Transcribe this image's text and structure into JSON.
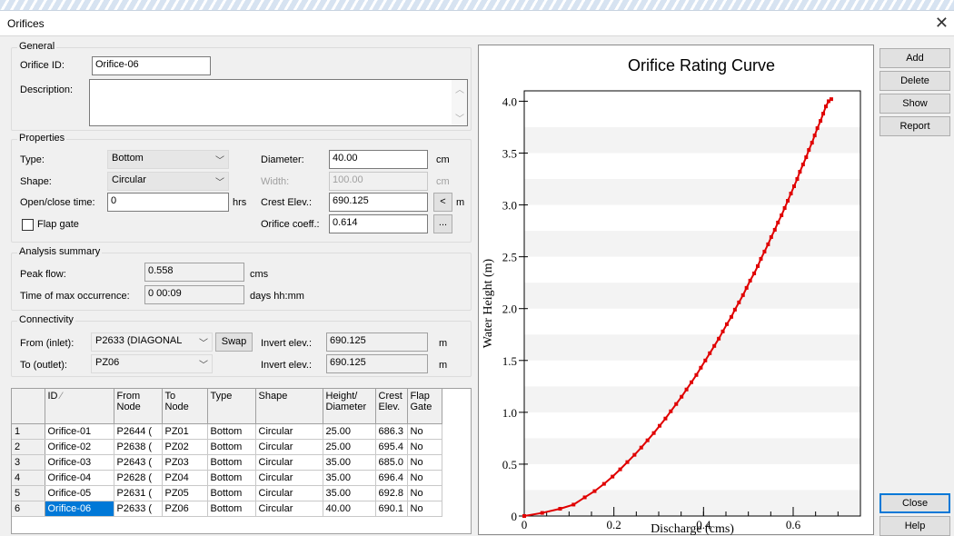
{
  "window": {
    "title": "Orifices",
    "close_glyph": "✕"
  },
  "general": {
    "group_label": "General",
    "orifice_id_label": "Orifice ID:",
    "orifice_id_value": "Orifice-06",
    "description_label": "Description:",
    "description_value": ""
  },
  "properties": {
    "group_label": "Properties",
    "type_label": "Type:",
    "type_value": "Bottom",
    "shape_label": "Shape:",
    "shape_value": "Circular",
    "open_close_label": "Open/close time:",
    "open_close_value": "0",
    "open_close_unit": "hrs",
    "flap_gate_label": "Flap gate",
    "flap_gate_checked": false,
    "diameter_label": "Diameter:",
    "diameter_value": "40.00",
    "diameter_unit": "cm",
    "width_label": "Width:",
    "width_value": "100.00",
    "width_unit": "cm",
    "crest_elev_label": "Crest Elev.:",
    "crest_elev_value": "690.125",
    "crest_elev_btn": "<",
    "crest_elev_unit": "m",
    "coeff_label": "Orifice coeff.:",
    "coeff_value": "0.614",
    "coeff_btn": "..."
  },
  "analysis": {
    "group_label": "Analysis summary",
    "peak_flow_label": "Peak flow:",
    "peak_flow_value": "0.558",
    "peak_flow_unit": "cms",
    "time_max_label": "Time of max occurrence:",
    "time_max_value": "0  00:09",
    "time_max_unit": "days hh:mm"
  },
  "connectivity": {
    "group_label": "Connectivity",
    "from_label": "From (inlet):",
    "from_value": "P2633 (DIAGONAL",
    "to_label": "To (outlet):",
    "to_value": "PZ06",
    "swap_label": "Swap",
    "invert1_label": "Invert elev.:",
    "invert1_value": "690.125",
    "invert1_unit": "m",
    "invert2_label": "Invert elev.:",
    "invert2_value": "690.125",
    "invert2_unit": "m"
  },
  "table": {
    "headers": [
      "",
      "ID",
      "From\nNode",
      "To\nNode",
      "Type",
      "Shape",
      "Height/\nDiameter",
      "Crest\nElev.",
      "Flap\nGate"
    ],
    "rows": [
      [
        "1",
        "Orifice-01",
        "P2644 (",
        "PZ01",
        "Bottom",
        "Circular",
        "25.00",
        "686.3",
        "No"
      ],
      [
        "2",
        "Orifice-02",
        "P2638 (",
        "PZ02",
        "Bottom",
        "Circular",
        "25.00",
        "695.4",
        "No"
      ],
      [
        "3",
        "Orifice-03",
        "P2643 (",
        "PZ03",
        "Bottom",
        "Circular",
        "35.00",
        "685.0",
        "No"
      ],
      [
        "4",
        "Orifice-04",
        "P2628 (",
        "PZ04",
        "Bottom",
        "Circular",
        "35.00",
        "696.4",
        "No"
      ],
      [
        "5",
        "Orifice-05",
        "P2631 (",
        "PZ05",
        "Bottom",
        "Circular",
        "35.00",
        "692.8",
        "No"
      ],
      [
        "6",
        "Orifice-06",
        "P2633 (",
        "PZ06",
        "Bottom",
        "Circular",
        "40.00",
        "690.1",
        "No"
      ]
    ],
    "selected_row": 5
  },
  "side_buttons": {
    "add": "Add",
    "delete": "Delete",
    "show": "Show",
    "report": "Report",
    "close": "Close",
    "help": "Help"
  },
  "colors": {
    "curve": "#e00000",
    "accent": "#0078d7"
  },
  "chart_data": {
    "type": "line",
    "title": "Orifice Rating Curve",
    "xlabel": "Discharge (cms)",
    "ylabel": "Water Height (m)",
    "xlim": [
      0,
      0.75
    ],
    "ylim": [
      0,
      4.1
    ],
    "xticks": [
      "0",
      "0.2",
      "0.4",
      "0.6"
    ],
    "yticks": [
      "0",
      "0.5",
      "1.0",
      "1.5",
      "2.0",
      "2.5",
      "3.0",
      "3.5",
      "4.0"
    ],
    "series": [
      {
        "x": [
          0,
          0.04,
          0.08,
          0.11,
          0.135,
          0.157,
          0.178,
          0.197,
          0.214,
          0.23,
          0.246,
          0.261,
          0.275,
          0.289,
          0.302,
          0.315,
          0.327,
          0.339,
          0.351,
          0.362,
          0.373,
          0.384,
          0.394,
          0.404,
          0.414,
          0.424,
          0.434,
          0.443,
          0.452,
          0.462,
          0.47,
          0.479,
          0.488,
          0.496,
          0.504,
          0.513,
          0.521,
          0.528,
          0.536,
          0.544,
          0.551,
          0.559,
          0.566,
          0.574,
          0.581,
          0.588,
          0.595,
          0.602,
          0.609,
          0.615,
          0.622,
          0.629,
          0.635,
          0.642,
          0.648,
          0.654,
          0.661,
          0.667,
          0.673,
          0.679,
          0.685
        ],
        "y": [
          0.0,
          0.03,
          0.07,
          0.11,
          0.18,
          0.24,
          0.31,
          0.38,
          0.45,
          0.52,
          0.59,
          0.66,
          0.73,
          0.8,
          0.87,
          0.94,
          1.01,
          1.08,
          1.15,
          1.22,
          1.29,
          1.36,
          1.43,
          1.5,
          1.57,
          1.64,
          1.71,
          1.78,
          1.85,
          1.92,
          1.99,
          2.06,
          2.13,
          2.2,
          2.27,
          2.34,
          2.41,
          2.48,
          2.55,
          2.62,
          2.69,
          2.76,
          2.83,
          2.9,
          2.97,
          3.04,
          3.11,
          3.18,
          3.25,
          3.32,
          3.39,
          3.46,
          3.53,
          3.6,
          3.67,
          3.74,
          3.81,
          3.88,
          3.95,
          4.0,
          4.02
        ]
      }
    ],
    "grid": "horizontal bands"
  }
}
